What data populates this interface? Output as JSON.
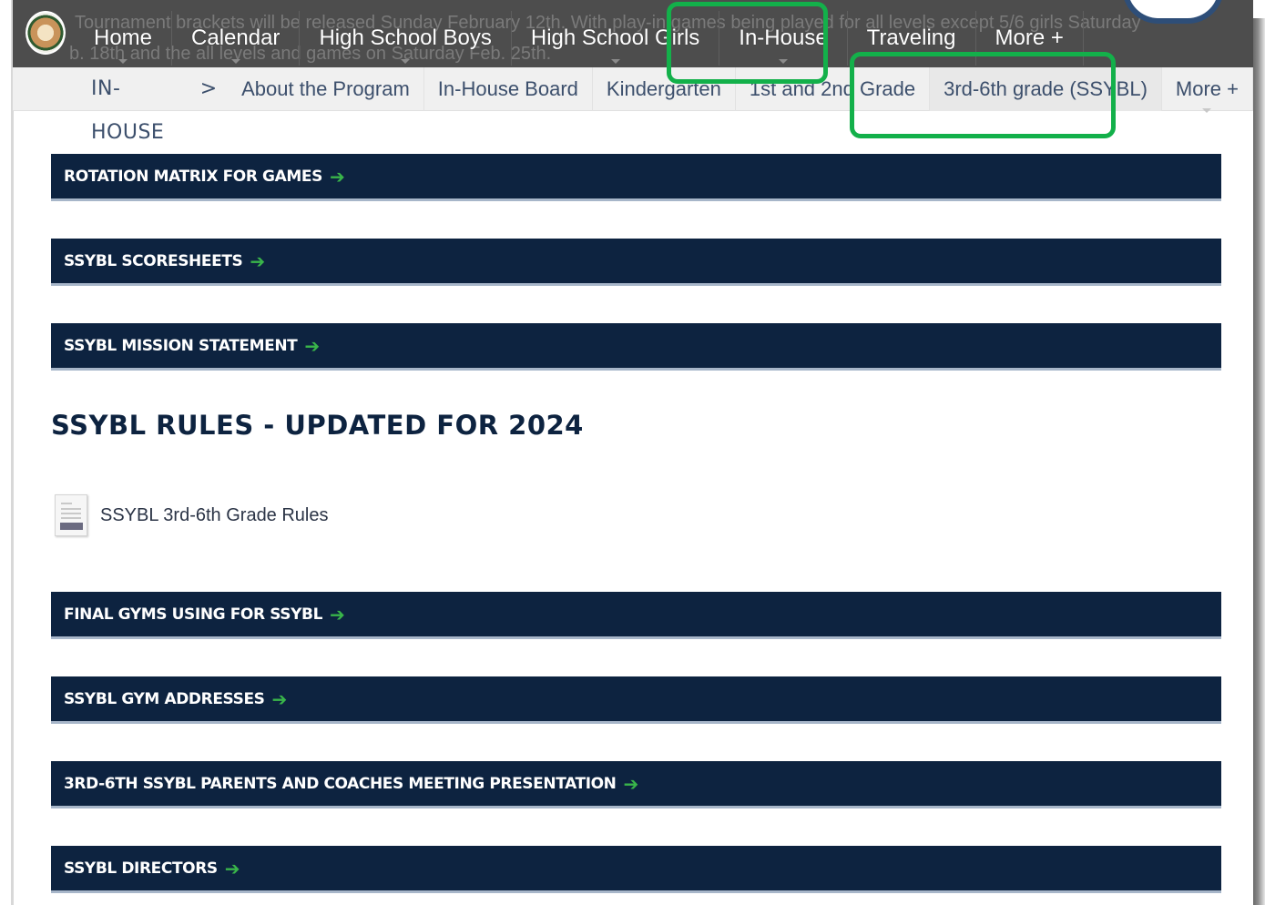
{
  "ticker": {
    "line1": "Tournament brackets will be released Sunday February 12th. With play-in games being played for all levels except 5/6 girls Saturday",
    "line2": "b. 18th and the all levels and games on Saturday Feb. 25th."
  },
  "main_nav": {
    "items": [
      {
        "label": "Home"
      },
      {
        "label": "Calendar"
      },
      {
        "label": "High School Boys"
      },
      {
        "label": "High School Girls"
      },
      {
        "label": "In-House"
      },
      {
        "label": "Traveling"
      },
      {
        "label": "More +"
      }
    ]
  },
  "sub_nav": {
    "crumb": "IN-HOUSE",
    "separator": ">",
    "items": [
      {
        "label": "About the Program"
      },
      {
        "label": "In-House Board"
      },
      {
        "label": "Kindergarten"
      },
      {
        "label": "1st and 2nd Grade"
      },
      {
        "label": "3rd-6th grade (SSYBL)"
      },
      {
        "label": "More +"
      }
    ]
  },
  "sections": {
    "rotation": "ROTATION MATRIX FOR GAMES",
    "scoresheets": "SSYBL SCORESHEETS",
    "mission": "SSYBL MISSION STATEMENT",
    "gyms": "FINAL GYMS USING FOR SSYBL",
    "addresses": "SSYBL GYM ADDRESSES",
    "meeting": "3RD-6TH SSYBL PARENTS AND COACHES MEETING PRESENTATION",
    "directors": "SSYBL DIRECTORS"
  },
  "rules": {
    "heading": "SSYBL RULES - UPDATED FOR 2024",
    "document_name": "SSYBL 3rd-6th Grade Rules"
  },
  "icons": {
    "arrow": "➔"
  },
  "colors": {
    "bar_bg": "#0d2340",
    "arrow": "#39b54a",
    "highlight": "#13b04a"
  }
}
